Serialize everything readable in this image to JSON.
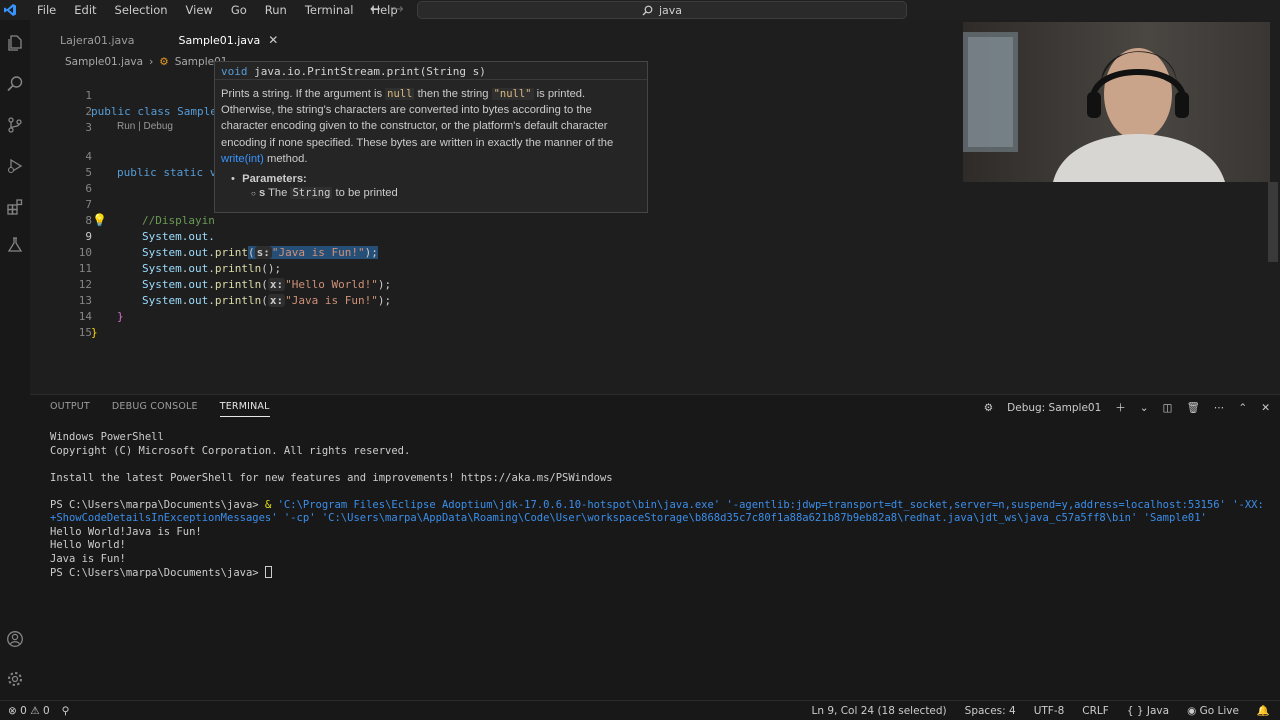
{
  "menu": [
    "File",
    "Edit",
    "Selection",
    "View",
    "Go",
    "Run",
    "Terminal",
    "Help"
  ],
  "search": {
    "text": "java"
  },
  "tabs": [
    {
      "label": "Lajera01.java",
      "active": false
    },
    {
      "label": "Sample01.java",
      "active": true
    }
  ],
  "breadcrumb": {
    "file": "Sample01.java",
    "symbol": "Sample01"
  },
  "editor": {
    "codelens": "Run | Debug",
    "lines": [
      {
        "n": "1",
        "text": "public class Sample"
      },
      {
        "n": "2",
        "text": ""
      },
      {
        "n": "3",
        "text": ""
      },
      {
        "n": "4",
        "text": "public static v"
      },
      {
        "n": "5",
        "text": ""
      },
      {
        "n": "6",
        "text": ""
      },
      {
        "n": "7",
        "text": "//Displayin"
      },
      {
        "n": "8",
        "text": "System.out."
      },
      {
        "n": "9",
        "text": "System.out.print(s:\"Java is Fun!\");"
      },
      {
        "n": "10",
        "text": "System.out.println();"
      },
      {
        "n": "11",
        "text": "System.out.println(x:\"Hello World!\");"
      },
      {
        "n": "12",
        "text": "System.out.println(x:\"Java is Fun!\");"
      },
      {
        "n": "13",
        "text": "}"
      },
      {
        "n": "14",
        "text": "}"
      },
      {
        "n": "15",
        "text": ""
      }
    ]
  },
  "hover": {
    "signature_kw": "void",
    "signature": "java.io.PrintStream.print(String s)",
    "desc1": "Prints a string. If the argument is",
    "code_null": "null",
    "desc2": "then the string",
    "code_qnull": "\"null\"",
    "desc3": "is printed.",
    "desc4": "Otherwise, the string's characters are converted into bytes according to the character encoding given to the constructor, or the platform's default character encoding if none specified. These bytes are written in exactly the manner of the",
    "link": "write(int)",
    "desc5": "method.",
    "params_label": "Parameters:",
    "param_name": "s",
    "param_the": "The",
    "param_type": "String",
    "param_desc": "to be printed"
  },
  "panel": {
    "tabs": [
      "OUTPUT",
      "DEBUG CONSOLE",
      "TERMINAL"
    ],
    "debug_label": "Debug: Sample01"
  },
  "terminal": {
    "l1": "Windows PowerShell",
    "l2": "Copyright (C) Microsoft Corporation. All rights reserved.",
    "l3": "Install the latest PowerShell for new features and improvements! https://aka.ms/PSWindows",
    "prompt": "PS C:\\Users\\marpa\\Documents\\java>",
    "amp": "&",
    "arg1": "'C:\\Program Files\\Eclipse Adoptium\\jdk-17.0.6.10-hotspot\\bin\\java.exe'",
    "arg2": "'-agentlib:jdwp=transport=dt_socket,server=n,suspend=y,address=localhost:53156'",
    "arg3": "'-XX:+ShowCodeDetailsInExceptionMessages'",
    "arg4": "'-cp'",
    "arg5": "'C:\\Users\\marpa\\AppData\\Roaming\\Code\\User\\workspaceStorage\\b868d35c7c80f1a88a621b87b9eb82a8\\redhat.java\\jdt_ws\\java_c57a5ff8\\bin'",
    "arg6": "'Sample01'",
    "out1": "Hello World!Java is Fun!",
    "out2": "Hello World!",
    "out3": "Java is Fun!",
    "prompt2": "PS C:\\Users\\marpa\\Documents\\java>"
  },
  "status": {
    "errors": "0",
    "warnings": "0",
    "position": "Ln 9, Col 24 (18 selected)",
    "spaces": "Spaces: 4",
    "encoding": "UTF-8",
    "eol": "CRLF",
    "language": "Java",
    "golive": "Go Live"
  },
  "colors": {
    "accent": "#007acc",
    "selection": "#264f78"
  }
}
